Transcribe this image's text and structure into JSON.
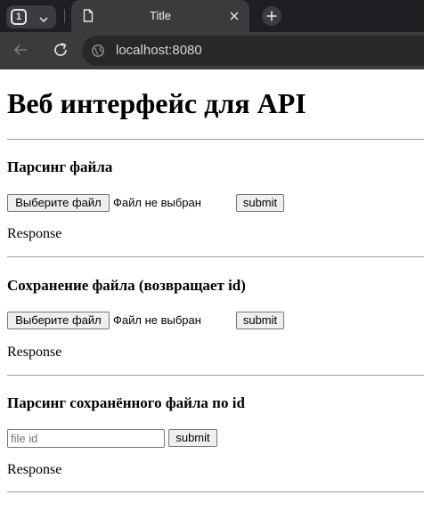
{
  "browser": {
    "tab_count": "1",
    "tab_title": "Title",
    "url": "localhost:8080"
  },
  "page": {
    "heading": "Веб интерфейс для API",
    "sections": [
      {
        "title": "Парсинг файла",
        "file_button_label": "Выберите файл",
        "file_status": "Файл не выбран",
        "submit_label": "submit",
        "response_label": "Response"
      },
      {
        "title": "Сохранение файла (возвращает id)",
        "file_button_label": "Выберите файл",
        "file_status": "Файл не выбран",
        "submit_label": "submit",
        "response_label": "Response"
      },
      {
        "title": "Парсинг сохранённого файла по id",
        "id_input_placeholder": "file id",
        "id_input_value": "",
        "submit_label": "submit",
        "response_label": "Response"
      }
    ]
  },
  "icons": {
    "tab_switcher": "chevron-down-icon",
    "tab_page": "page-icon",
    "tab_close": "close-icon",
    "new_tab": "plus-icon",
    "back": "arrow-left-icon",
    "reload": "reload-icon",
    "site_info": "site-info-icon"
  },
  "colors": {
    "chrome_dark": "#1f1f23",
    "chrome_toolbar": "#3b3b3e",
    "page_background": "#ffffff"
  }
}
